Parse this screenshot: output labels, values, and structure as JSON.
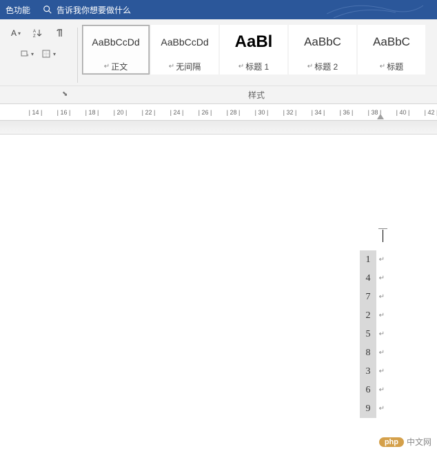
{
  "titlebar": {
    "feature_text": "色功能",
    "tell_me_placeholder": "告诉我你想要做什么"
  },
  "ribbon": {
    "paragraph_launcher": "⬊",
    "styles_group_label": "样式",
    "styles": [
      {
        "preview": "AaBbCcDd",
        "label": "正文",
        "class": "body",
        "selected": true
      },
      {
        "preview": "AaBbCcDd",
        "label": "无间隔",
        "class": "body",
        "selected": false
      },
      {
        "preview": "AaBl",
        "label": "标题 1",
        "class": "heading1",
        "selected": false
      },
      {
        "preview": "AaBbC",
        "label": "标题 2",
        "class": "heading2",
        "selected": false
      },
      {
        "preview": "AaBbC",
        "label": "标题",
        "class": "heading3",
        "selected": false
      }
    ]
  },
  "ruler": {
    "marks": [
      "",
      "| 14 |",
      "| 16 |",
      "| 18 |",
      "| 20 |",
      "| 22 |",
      "| 24 |",
      "| 26 |",
      "| 28 |",
      "| 30 |",
      "| 32 |",
      "| 34 |",
      "| 36 |",
      "| 38 |",
      "| 40 |",
      "| 42 |",
      ""
    ]
  },
  "document": {
    "lines": [
      "1",
      "4",
      "7",
      "2",
      "5",
      "8",
      "3",
      "6",
      "9"
    ]
  },
  "watermark": {
    "badge": "php",
    "text": "中文网"
  }
}
